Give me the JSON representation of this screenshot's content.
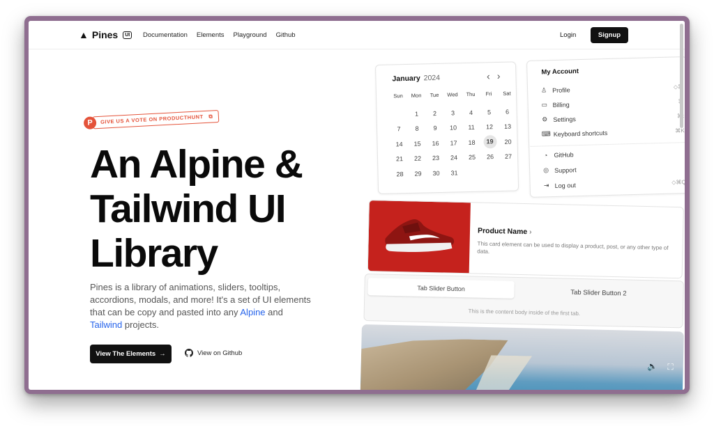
{
  "nav": {
    "brand": "Pines",
    "brand_badge": "UI",
    "links": [
      "Documentation",
      "Elements",
      "Playground",
      "Github"
    ],
    "login": "Login",
    "signup": "Signup"
  },
  "producthunt": {
    "icon_letter": "P",
    "label": "GIVE US A VOTE ON PRODUCTHUNT",
    "icon": "external-link-icon"
  },
  "hero": {
    "lines": [
      "An Alpine &",
      "Tailwind UI",
      "Library"
    ],
    "desc_prefix": "Pines is a library of animations, sliders, tooltips, accordions, modals, and more! It's a set of UI elements that can be copy and pasted into any ",
    "desc_link1": "Alpine",
    "desc_mid": " and ",
    "desc_link2": "Tailwind",
    "desc_suffix": " projects.",
    "btn_primary": "View The Elements",
    "btn_primary_icon": "→",
    "btn_secondary": "View on Github"
  },
  "calendar": {
    "month": "January",
    "year": "2024",
    "dow": [
      "Sun",
      "Mon",
      "Tue",
      "Wed",
      "Thu",
      "Fri",
      "Sat"
    ],
    "days": [
      "",
      "1",
      "2",
      "3",
      "4",
      "5",
      "6",
      "7",
      "8",
      "9",
      "10",
      "11",
      "12",
      "13",
      "14",
      "15",
      "16",
      "17",
      "18",
      "19",
      "20",
      "21",
      "22",
      "23",
      "24",
      "25",
      "26",
      "27",
      "28",
      "29",
      "30",
      "31"
    ],
    "selected": "19"
  },
  "menu": {
    "title": "My Account",
    "items": [
      {
        "label": "Profile",
        "icon": "user-icon",
        "glyph": "♙",
        "kb": "◇⌘"
      },
      {
        "label": "Billing",
        "icon": "credit-card-icon",
        "glyph": "▭",
        "kb": "⌘"
      },
      {
        "label": "Settings",
        "icon": "gear-icon",
        "glyph": "⚙",
        "kb": "⌘:"
      },
      {
        "label": "Keyboard shortcuts",
        "icon": "keyboard-icon",
        "glyph": "⌨",
        "kb": "⌘K"
      },
      {
        "label": "GitHub",
        "icon": "github-icon",
        "glyph": "◔",
        "kb": ""
      },
      {
        "label": "Support",
        "icon": "lifebuoy-icon",
        "glyph": "◎",
        "kb": ""
      },
      {
        "label": "Log out",
        "icon": "logout-icon",
        "glyph": "⇥",
        "kb": "◇⌘Q"
      }
    ]
  },
  "product": {
    "name": "Product Name",
    "arrow": "›",
    "description": "This card element can be used to display a product, post, or any other type of data."
  },
  "tabs": {
    "tab1": "Tab Slider Button",
    "tab2": "Tab Slider Button 2",
    "body": "This is the content body inside of the first tab."
  },
  "video": {
    "volume_icon": "volume-icon",
    "fullscreen_icon": "fullscreen-icon"
  }
}
